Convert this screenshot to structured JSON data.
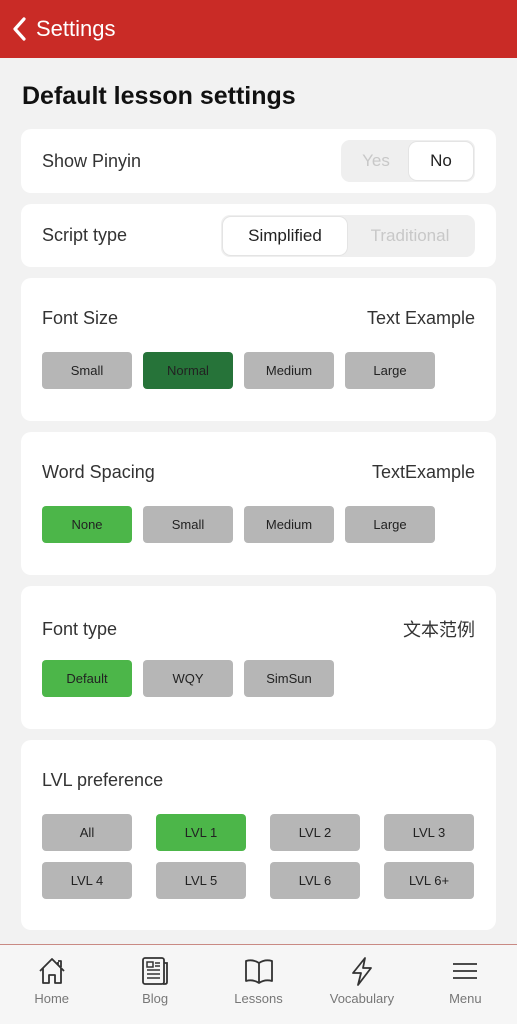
{
  "header": {
    "back_label": "Settings"
  },
  "page_title": "Default lesson settings",
  "show_pinyin": {
    "label": "Show Pinyin",
    "options": [
      "Yes",
      "No"
    ],
    "selected": "No"
  },
  "script_type": {
    "label": "Script type",
    "options": [
      "Simplified",
      "Traditional"
    ],
    "selected": "Simplified"
  },
  "font_size": {
    "title": "Font Size",
    "sample": "Text Example",
    "options": [
      "Small",
      "Normal",
      "Medium",
      "Large"
    ],
    "selected": "Normal"
  },
  "word_spacing": {
    "title": "Word Spacing",
    "sample": "TextExample",
    "options": [
      "None",
      "Small",
      "Medium",
      "Large"
    ],
    "selected": "None"
  },
  "font_type": {
    "title": "Font type",
    "sample": "文本范例",
    "options": [
      "Default",
      "WQY",
      "SimSun"
    ],
    "selected": "Default"
  },
  "lvl_preference": {
    "title": "LVL preference",
    "options": [
      "All",
      "LVL 1",
      "LVL 2",
      "LVL 3",
      "LVL 4",
      "LVL 5",
      "LVL 6",
      "LVL 6+"
    ],
    "selected": "LVL 1"
  },
  "nav": [
    {
      "label": "Home",
      "icon": "home-icon"
    },
    {
      "label": "Blog",
      "icon": "newspaper-icon"
    },
    {
      "label": "Lessons",
      "icon": "book-icon"
    },
    {
      "label": "Vocabulary",
      "icon": "lightning-icon"
    },
    {
      "label": "Menu",
      "icon": "menu-icon"
    }
  ],
  "colors": {
    "header": "#c92b26",
    "selected_green": "#4cb649",
    "selected_dark_green": "#267339",
    "unselected": "#b6b6b6"
  }
}
